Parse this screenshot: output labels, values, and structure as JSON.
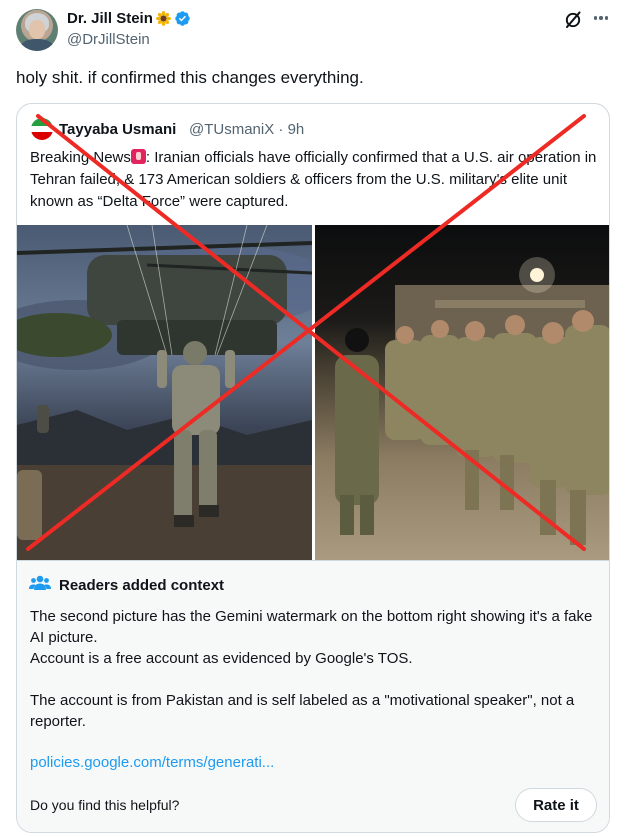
{
  "tweet": {
    "author_name": "Dr. Jill Stein",
    "author_handle": "@DrJillStein",
    "text": "holy shit. if confirmed this changes everything."
  },
  "quote": {
    "author_name": "Tayyaba Usmani",
    "author_handle": "@TUsmaniX",
    "time": "· 9h",
    "text_before": "Breaking News",
    "text_after": ": Iranian officials have officially confirmed that a U.S. air operation in Tehran failed, & 173 American soldiers & officers from the U.S. military's elite unit known as “Delta Force” were captured."
  },
  "context": {
    "title": "Readers added context",
    "paragraphs": [
      "The second picture has the Gemini watermark on the bottom right showing it's a fake AI picture.",
      "Account is a free account as evidenced by Google's TOS.",
      "The account is from Pakistan and is self labeled as a \"motivational speaker\", not a reporter."
    ],
    "link": "policies.google.com/terms/generati...",
    "question": "Do you find this helpful?",
    "rate_label": "Rate it"
  },
  "icons": {
    "verified": "verified-badge-icon",
    "sunflower": "sunflower-emoji-icon",
    "grok": "grok-icon",
    "more": "more-icon",
    "readers": "readers-icon",
    "flag": "iran-flag-avatar",
    "siren": "siren-emoji-icon"
  },
  "colors": {
    "accent": "#1d9bf0",
    "cross": "#ee2a24",
    "text": "#0f1419",
    "secondary": "#536471"
  }
}
